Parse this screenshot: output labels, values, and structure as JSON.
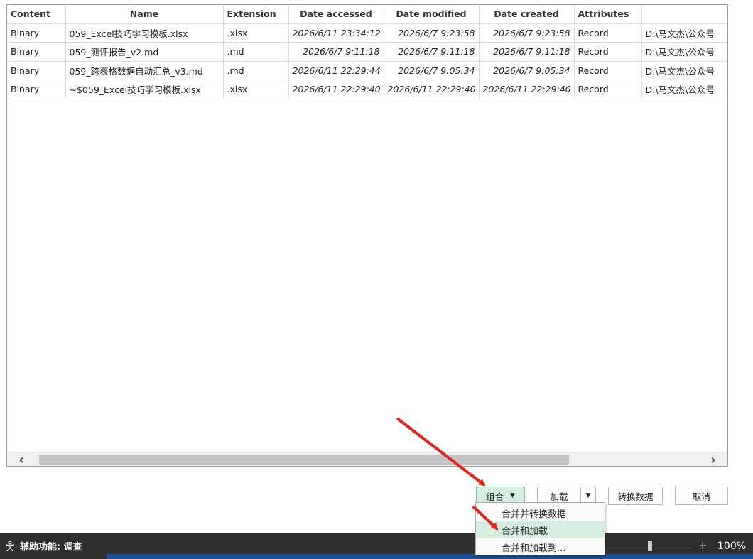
{
  "table": {
    "columns": [
      "Content",
      "Name",
      "Extension",
      "Date accessed",
      "Date modified",
      "Date created",
      "Attributes",
      ""
    ],
    "rows": [
      [
        "Binary",
        "059_Excel技巧学习模板.xlsx",
        ".xlsx",
        "2026/6/11 23:34:12",
        "2026/6/7 9:23:58",
        "2026/6/7 9:23:58",
        "Record",
        "D:\\马文杰\\公众号"
      ],
      [
        "Binary",
        "059_测评报告_v2.md",
        ".md",
        "2026/6/7 9:11:18",
        "2026/6/7 9:11:18",
        "2026/6/7 9:11:18",
        "Record",
        "D:\\马文杰\\公众号"
      ],
      [
        "Binary",
        "059_跨表格数据自动汇总_v3.md",
        ".md",
        "2026/6/11 22:29:44",
        "2026/6/7 9:05:34",
        "2026/6/7 9:05:34",
        "Record",
        "D:\\马文杰\\公众号"
      ],
      [
        "Binary",
        "~$059_Excel技巧学习模板.xlsx",
        ".xlsx",
        "2026/6/11 22:29:40",
        "2026/6/11 22:29:40",
        "2026/6/11 22:29:40",
        "Record",
        "D:\\马文杰\\公众号"
      ]
    ]
  },
  "buttons": {
    "combine": "组合",
    "load": "加载",
    "transform": "转换数据",
    "cancel": "取消"
  },
  "menu": {
    "items": [
      "合并并转换数据",
      "合并和加载",
      "合并和加载到..."
    ],
    "highlighted_index": 1
  },
  "status": {
    "accessibility": "辅助功能: 调查",
    "zoom": "100%"
  },
  "colors": {
    "highlight": "#d6eedf",
    "arrow": "#e0241c",
    "taskbar": "#2f2f2f"
  }
}
